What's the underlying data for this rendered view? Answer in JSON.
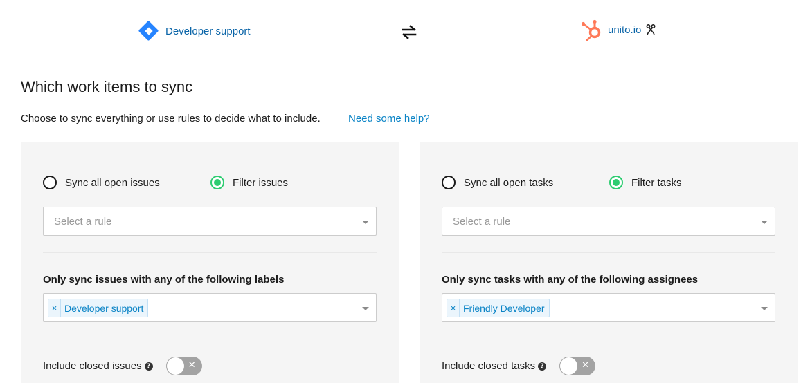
{
  "header": {
    "left_link": "Developer support",
    "right_link": "unito.io",
    "left_icon": "jira-diamond-icon",
    "swap_icon": "swap-arrows-icon",
    "right_icon": "hubspot-icon",
    "owner_icon": "owner-icon"
  },
  "page": {
    "title": "Which work items to sync",
    "subtitle": "Choose to sync everything or use rules to decide what to include.",
    "help_link": "Need some help?"
  },
  "left_panel": {
    "radio_all": "Sync all open issues",
    "radio_filter": "Filter issues",
    "selected": "Filter issues",
    "rule_placeholder": "Select a rule",
    "section_label": "Only sync issues with any of the following labels",
    "tag": "Developer support",
    "closed_label": "Include closed issues",
    "include_closed": false
  },
  "right_panel": {
    "radio_all": "Sync all open tasks",
    "radio_filter": "Filter tasks",
    "selected": "Filter tasks",
    "rule_placeholder": "Select a rule",
    "section_label": "Only sync tasks with any of the following assignees",
    "tag": "Friendly Developer",
    "closed_label": "Include closed tasks",
    "include_closed": false
  },
  "colors": {
    "link": "#0b65a8",
    "help_link": "#0b84c6",
    "radio_checked": "#2ecc71",
    "jira_blue": "#2684ff",
    "hubspot_orange": "#ff7a59",
    "panel_bg": "#f5f5f5",
    "toggle_off": "#a3a3a3"
  }
}
